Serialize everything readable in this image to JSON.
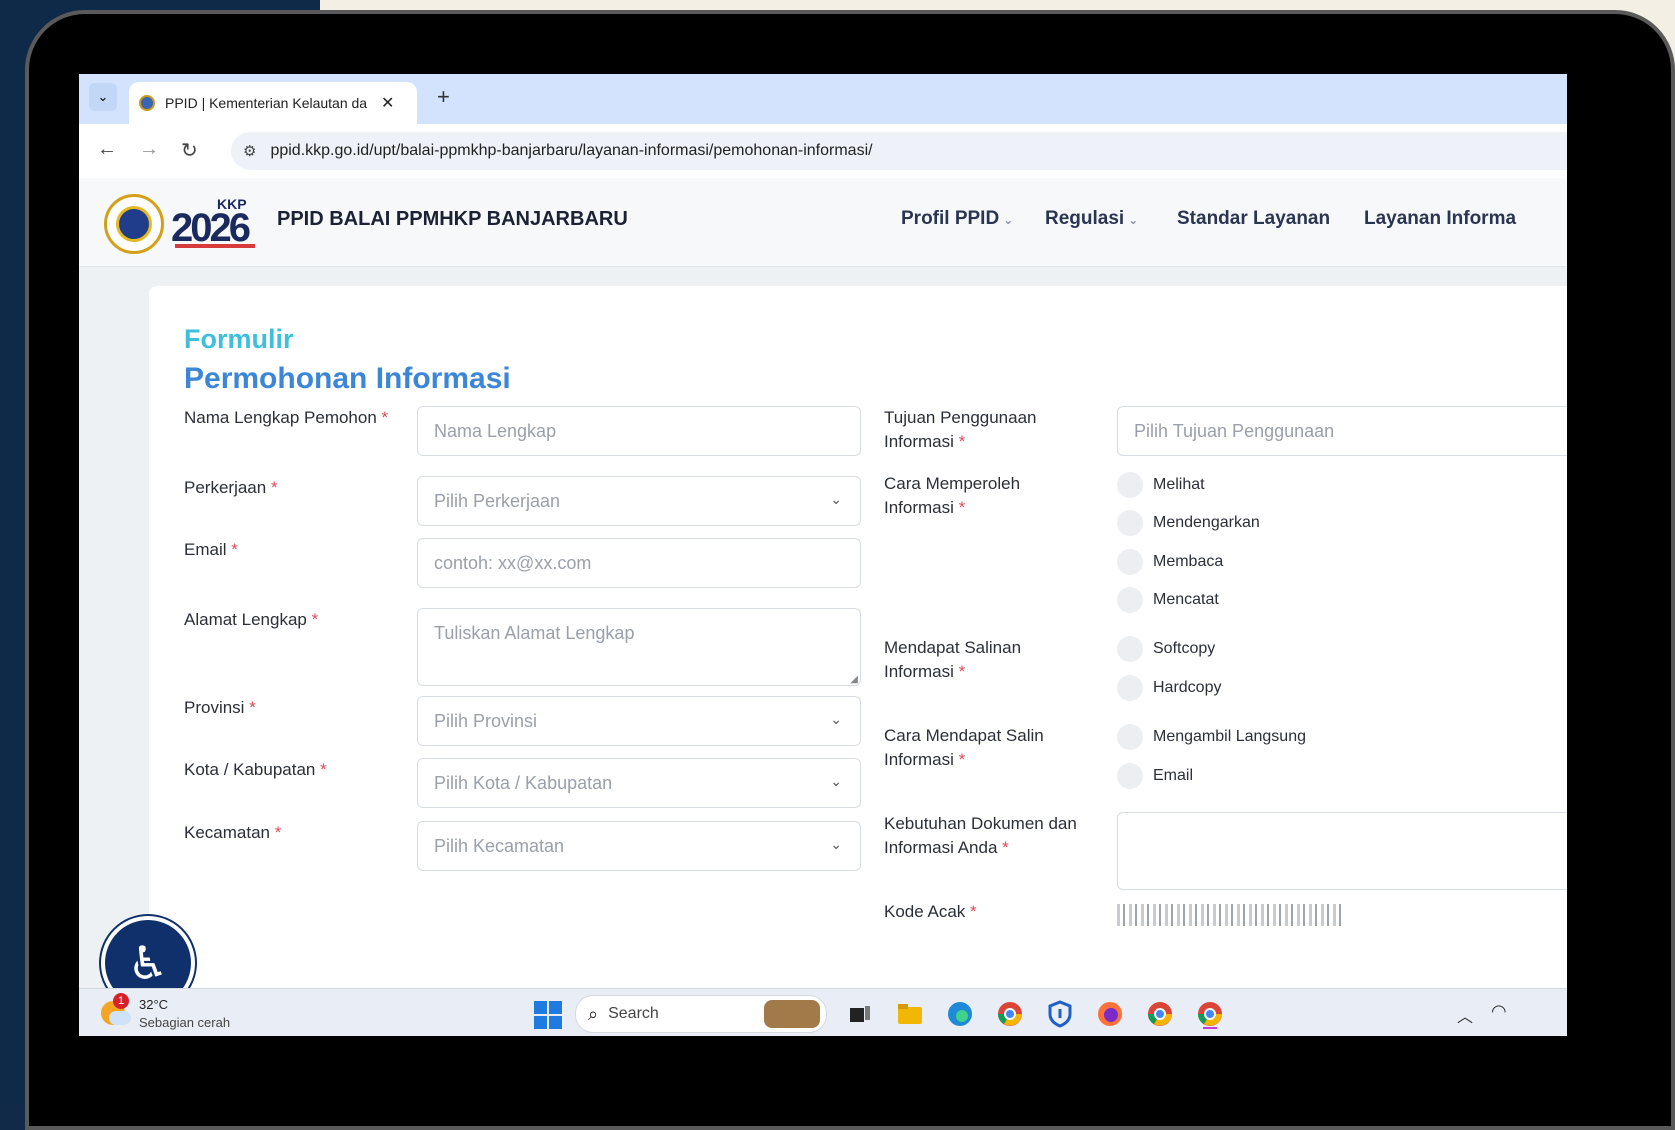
{
  "browser": {
    "tab_title": "PPID | Kementerian Kelautan da",
    "tab_close": "✕",
    "new_tab": "+",
    "url": "ppid.kkp.go.id/upt/balai-ppmkhp-banjarbaru/layanan-informasi/pemohonan-informasi/"
  },
  "site": {
    "logo_text": "KKP",
    "logo_year": "2026",
    "name": "PPID BALAI PPMHKP BANJARBARU",
    "nav": [
      {
        "label": "Profil PPID",
        "dropdown": true
      },
      {
        "label": "Regulasi",
        "dropdown": true
      },
      {
        "label": "Standar Layanan",
        "dropdown": false
      },
      {
        "label": "Layanan Informa",
        "dropdown": false
      }
    ]
  },
  "form": {
    "title_small": "Formulir",
    "title_big": "Permohonan Informasi",
    "required_mark": "*",
    "nama_label": "Nama Lengkap Pemohon",
    "nama_ph": "Nama Lengkap",
    "perkerjaan_label": "Perkerjaan",
    "perkerjaan_ph": "Pilih Perkerjaan",
    "email_label": "Email",
    "email_ph": "contoh: xx@xx.com",
    "alamat_label": "Alamat Lengkap",
    "alamat_ph": "Tuliskan Alamat Lengkap",
    "provinsi_label": "Provinsi",
    "provinsi_ph": "Pilih Provinsi",
    "kota_label": "Kota / Kabupatan",
    "kota_ph": "Pilih Kota / Kabupatan",
    "kecamatan_label": "Kecamatan",
    "kecamatan_ph": "Pilih Kecamatan",
    "tujuan_label": "Tujuan Penggunaan Informasi",
    "tujuan_ph": "Pilih Tujuan Penggunaan",
    "cara_label": "Cara Memperoleh Informasi",
    "cara_opts": [
      "Melihat",
      "Mendengarkan",
      "Membaca",
      "Mencatat"
    ],
    "salinan_label": "Mendapat Salinan Informasi",
    "salinan_opts": [
      "Softcopy",
      "Hardcopy"
    ],
    "cara_salin_label": "Cara Mendapat Salin Informasi",
    "cara_salin_opts": [
      "Mengambil Langsung",
      "Email"
    ],
    "kebutuhan_label": "Kebutuhan Dokumen dan Informasi Anda",
    "kode_label": "Kode Acak"
  },
  "taskbar": {
    "weather_badge": "1",
    "temp": "32°C",
    "weather": "Sebagian cerah",
    "search": "Search"
  }
}
